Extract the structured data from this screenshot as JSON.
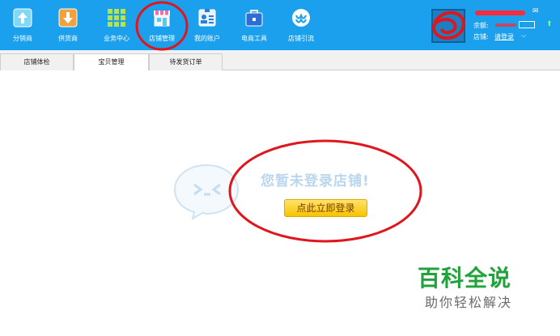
{
  "toolbar": {
    "items": [
      {
        "label": "分销商",
        "icon": "distributor-icon"
      },
      {
        "label": "供货商",
        "icon": "supplier-icon"
      },
      {
        "label": "业务中心",
        "icon": "business-center-icon"
      },
      {
        "label": "店铺管理",
        "icon": "store-icon"
      },
      {
        "label": "我的账户",
        "icon": "account-icon"
      },
      {
        "label": "电商工具",
        "icon": "toolbox-icon"
      },
      {
        "label": "店铺引流",
        "icon": "traffic-icon"
      }
    ]
  },
  "account": {
    "balance_label": "余额:",
    "store_label": "店铺:",
    "store_value": "请登录"
  },
  "tabs": [
    {
      "label": "店铺体检",
      "active": false
    },
    {
      "label": "宝贝管理",
      "active": true
    },
    {
      "label": "待发货订单",
      "active": false
    }
  ],
  "main": {
    "empty_message": "您暂未登录店铺!",
    "login_button": "点此立即登录"
  },
  "watermark": {
    "title": "百科全说",
    "subtitle": "助你轻松解决"
  },
  "colors": {
    "toolbar_bg": "#1aa0ec",
    "annotation_red": "#e0161d",
    "login_button": "#f7c400",
    "watermark_green": "#1fa33a"
  }
}
